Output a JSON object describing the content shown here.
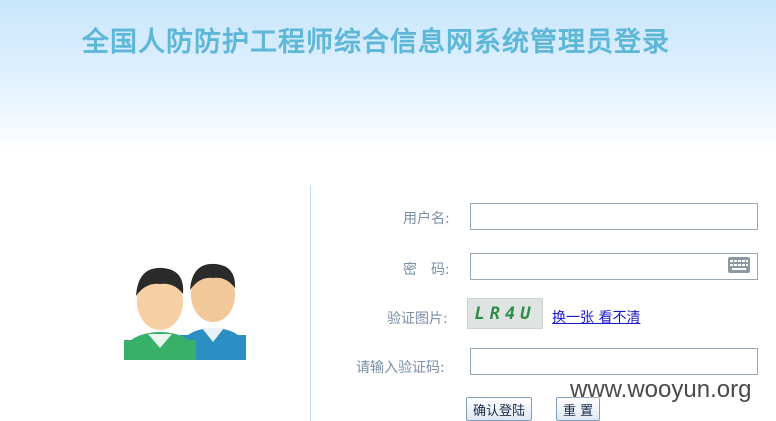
{
  "header": {
    "title": "全国人防防护工程师综合信息网系统管理员登录"
  },
  "form": {
    "username_label": "用户名:",
    "username_value": "",
    "password_label": "密　码:",
    "password_value": "",
    "captcha_label": "验证图片:",
    "captcha_text": "LR4U",
    "captcha_refresh_link": "换一张 看不清",
    "captcha_input_label": "请输入验证码:",
    "captcha_input_value": ""
  },
  "buttons": {
    "login": "确认登陆",
    "reset": "重 置"
  },
  "icons": {
    "avatar": "users-avatar-icon",
    "keyboard": "keyboard-icon"
  },
  "watermark": "www.wooyun.org",
  "colors": {
    "title": "#5fb7d8",
    "header_gradient_top": "#c9e6fb",
    "label": "#7a8ea6",
    "link": "#1a1acc"
  }
}
